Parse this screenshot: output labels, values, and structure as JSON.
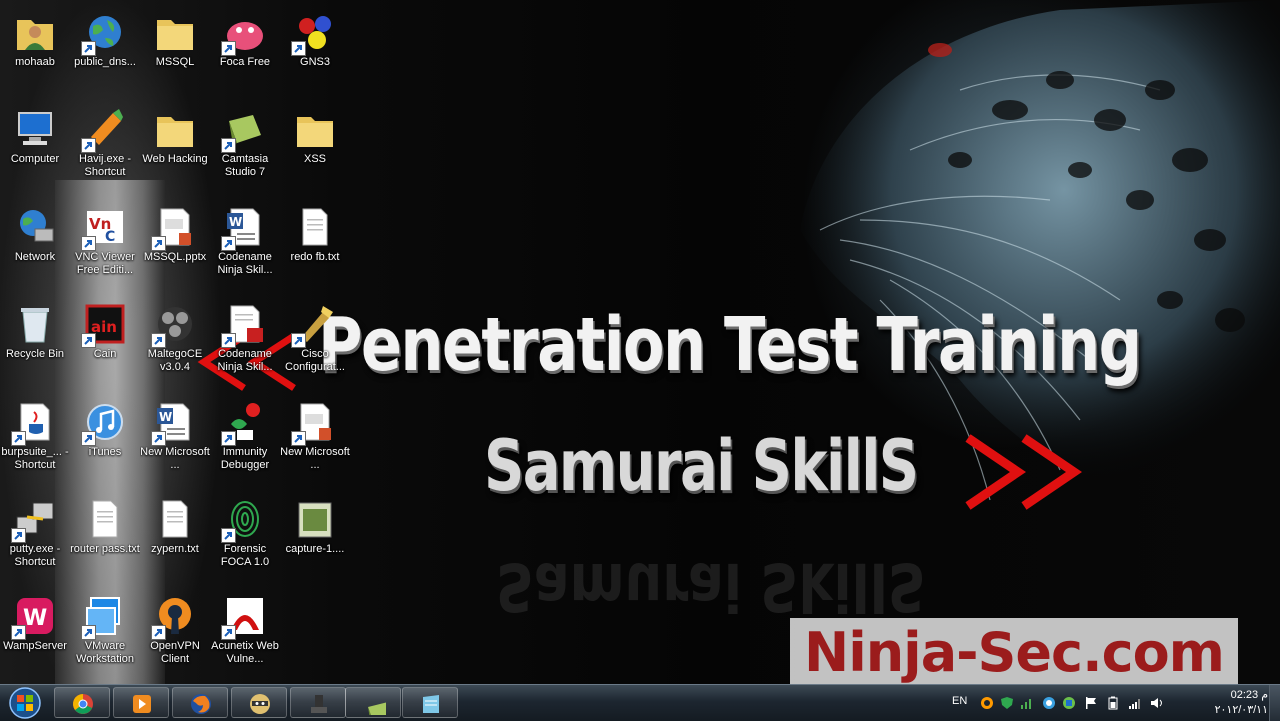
{
  "wallpaper": {
    "headline": "Penetration Test Training",
    "subline": "Samurai SkillS",
    "subline_reflection": "Samurai SkillS",
    "arrows_right": ">>",
    "arrows_left": "<<",
    "watermark": "Ninja-Sec.com",
    "accent_red": "#e01010",
    "watermark_color": "#9b1c1c"
  },
  "desktop_icons": [
    {
      "label": "mohaab",
      "icon": "user-folder-icon"
    },
    {
      "label": "public_dns...",
      "icon": "globe-icon"
    },
    {
      "label": "MSSQL",
      "icon": "folder-icon"
    },
    {
      "label": "Foca Free",
      "icon": "foca-icon"
    },
    {
      "label": "GNS3",
      "icon": "gns3-icon"
    },
    {
      "label": "Computer",
      "icon": "computer-icon"
    },
    {
      "label": "Havij.exe - Shortcut",
      "icon": "havij-icon"
    },
    {
      "label": "Web Hacking",
      "icon": "folder-icon"
    },
    {
      "label": "Camtasia Studio 7",
      "icon": "camtasia-icon"
    },
    {
      "label": "XSS",
      "icon": "folder-icon"
    },
    {
      "label": "Network",
      "icon": "network-icon"
    },
    {
      "label": "VNC Viewer Free Editi...",
      "icon": "vnc-icon"
    },
    {
      "label": "MSSQL.pptx",
      "icon": "powerpoint-icon"
    },
    {
      "label": "Codename Ninja Skil...",
      "icon": "word-icon"
    },
    {
      "label": "redo fb.txt",
      "icon": "text-file-icon"
    },
    {
      "label": "Recycle Bin",
      "icon": "recycle-bin-icon"
    },
    {
      "label": "Cain",
      "icon": "cain-icon"
    },
    {
      "label": "MaltegoCE v3.0.4",
      "icon": "maltego-icon"
    },
    {
      "label": "Codename Ninja Skil...",
      "icon": "pdf-icon"
    },
    {
      "label": "Cisco Configurat...",
      "icon": "cisco-icon"
    },
    {
      "label": "burpsuite_... - Shortcut",
      "icon": "java-icon"
    },
    {
      "label": "iTunes",
      "icon": "itunes-icon"
    },
    {
      "label": "New Microsoft ...",
      "icon": "word-icon"
    },
    {
      "label": "Immunity Debugger",
      "icon": "immunity-icon"
    },
    {
      "label": "New Microsoft ...",
      "icon": "powerpoint-icon"
    },
    {
      "label": "putty.exe - Shortcut",
      "icon": "putty-icon"
    },
    {
      "label": "router pass.txt",
      "icon": "text-file-icon"
    },
    {
      "label": "zypern.txt",
      "icon": "text-file-icon"
    },
    {
      "label": "Forensic FOCA 1.0",
      "icon": "fingerprint-icon"
    },
    {
      "label": "capture-1....",
      "icon": "video-file-icon"
    },
    {
      "label": "WampServer",
      "icon": "wamp-icon"
    },
    {
      "label": "VMware Workstation",
      "icon": "vmware-icon"
    },
    {
      "label": "OpenVPN Client",
      "icon": "openvpn-icon"
    },
    {
      "label": "Acunetix Web Vulne...",
      "icon": "acunetix-icon"
    }
  ],
  "taskbar": {
    "buttons": [
      {
        "name": "chrome",
        "icon": "chrome-icon"
      },
      {
        "name": "media-player",
        "icon": "media-player-icon"
      },
      {
        "name": "firefox",
        "icon": "firefox-icon"
      },
      {
        "name": "ninja",
        "icon": "ninja-icon"
      },
      {
        "name": "tool",
        "icon": "tool-icon"
      },
      {
        "name": "camtasia",
        "icon": "camtasia-icon"
      },
      {
        "name": "notes",
        "icon": "notes-icon"
      }
    ],
    "language": "EN",
    "clock_time": "02:23 م",
    "clock_date": "٢٠١٢/٠٣/١١"
  }
}
